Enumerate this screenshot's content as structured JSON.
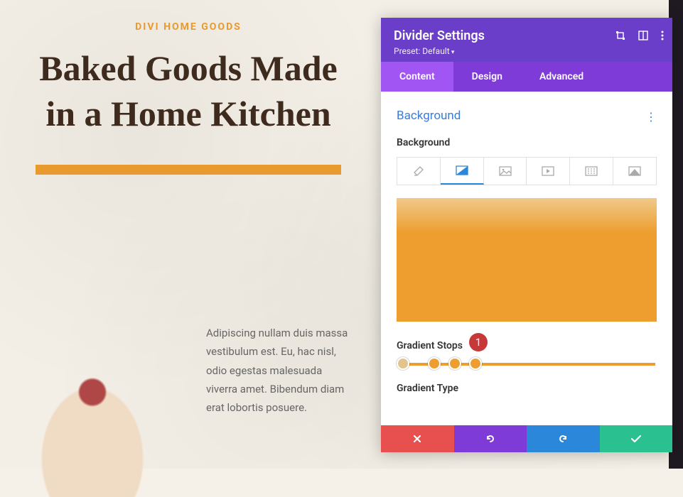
{
  "page": {
    "eyebrow": "DIVI HOME GOODS",
    "headline": "Baked Goods Made in a Home Kitchen",
    "body": "Adipiscing nullam duis massa vestibulum est. Eu, hac nisl, odio egestas malesuada viverra amet. Bibendum diam erat lobortis posuere."
  },
  "panel": {
    "title": "Divider Settings",
    "preset": "Preset: Default",
    "tabs": [
      "Content",
      "Design",
      "Advanced"
    ],
    "active_tab": 0,
    "section": "Background",
    "field_label": "Background",
    "gradient_stops_label": "Gradient Stops",
    "gradient_type_label": "Gradient Type",
    "annotation_badge": "1",
    "gradient": {
      "stops": [
        {
          "pos": 0,
          "color": "#e2c58d"
        },
        {
          "pos": 14,
          "color": "#ed9e2f"
        },
        {
          "pos": 22,
          "color": "#ed9e2f"
        },
        {
          "pos": 30,
          "color": "#ed9e2f"
        }
      ]
    },
    "bg_tab_icons": [
      "paint",
      "gradient",
      "image",
      "video",
      "pattern",
      "mask"
    ],
    "bg_active_tab": 1
  }
}
